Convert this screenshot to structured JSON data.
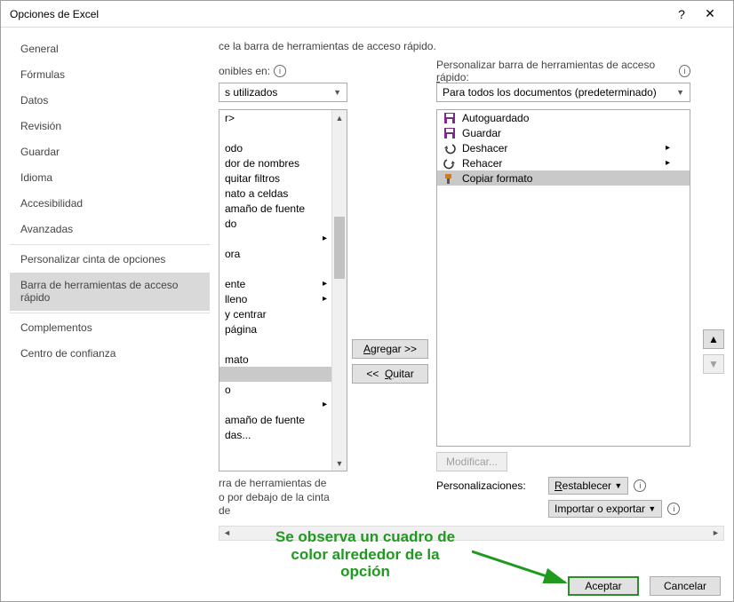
{
  "titlebar": {
    "title": "Opciones de Excel",
    "help": "?",
    "close": "✕"
  },
  "sidebar": {
    "items": [
      {
        "label": "General"
      },
      {
        "label": "Fórmulas"
      },
      {
        "label": "Datos"
      },
      {
        "label": "Revisión"
      },
      {
        "label": "Guardar"
      },
      {
        "label": "Idioma"
      },
      {
        "label": "Accesibilidad"
      },
      {
        "label": "Avanzadas"
      }
    ],
    "items2": [
      {
        "label": "Personalizar cinta de opciones"
      },
      {
        "label": "Barra de herramientas de acceso rápido",
        "selected": true
      }
    ],
    "items3": [
      {
        "label": "Complementos"
      },
      {
        "label": "Centro de confianza"
      }
    ]
  },
  "heading": "ce la barra de herramientas de acceso rápido.",
  "left": {
    "label": "onibles en:",
    "dropdown": "s utilizados",
    "items": [
      {
        "label": "r>"
      },
      {
        "label": ""
      },
      {
        "label": "odo"
      },
      {
        "label": "dor de nombres"
      },
      {
        "label": "quitar filtros"
      },
      {
        "label": "nato a celdas"
      },
      {
        "label": "amaño de fuente"
      },
      {
        "label": "do"
      },
      {
        "label": "",
        "submenu": true
      },
      {
        "label": "ora"
      },
      {
        "label": ""
      },
      {
        "label": "ente",
        "submenu": true
      },
      {
        "label": "lleno",
        "submenu": true
      },
      {
        "label": "y centrar"
      },
      {
        "label": "página"
      },
      {
        "label": ""
      },
      {
        "label": "mato"
      },
      {
        "label": "",
        "sel": true
      },
      {
        "label": "o"
      },
      {
        "label": "",
        "submenu": true
      },
      {
        "label": "amaño de fuente"
      },
      {
        "label": "das..."
      }
    ],
    "below1": "rra de herramientas de",
    "below2": "o por debajo de la cinta de"
  },
  "mid": {
    "agregar": "Agregar >>",
    "quitar": "<<  Quitar"
  },
  "right": {
    "label_a": "Personalizar barra de herramientas de acceso ",
    "label_u": "r",
    "label_b": "ápido:",
    "dropdown": "Para todos los documentos (predeterminado)",
    "items": [
      {
        "icon": "save",
        "color": "#7b2b8a",
        "label": "Autoguardado"
      },
      {
        "icon": "save",
        "color": "#7b2b8a",
        "label": "Guardar"
      },
      {
        "icon": "undo",
        "color": "#333",
        "label": "Deshacer",
        "submenu": true
      },
      {
        "icon": "redo",
        "color": "#333",
        "label": "Rehacer",
        "submenu": true
      },
      {
        "icon": "brush",
        "color": "#d37a1c",
        "label": "Copiar formato",
        "sel": true
      }
    ],
    "modificar": "Modificar...",
    "pers_label": "Personalizaciones:",
    "restablecer": "Restablecer",
    "importar": "Importar o exportar",
    "up": "▲",
    "down": "▼"
  },
  "footer": {
    "aceptar": "Aceptar",
    "cancelar": "Cancelar"
  },
  "annotation": {
    "l1": "Se observa un cuadro de",
    "l2": "color alrededor de la",
    "l3": "opción"
  }
}
